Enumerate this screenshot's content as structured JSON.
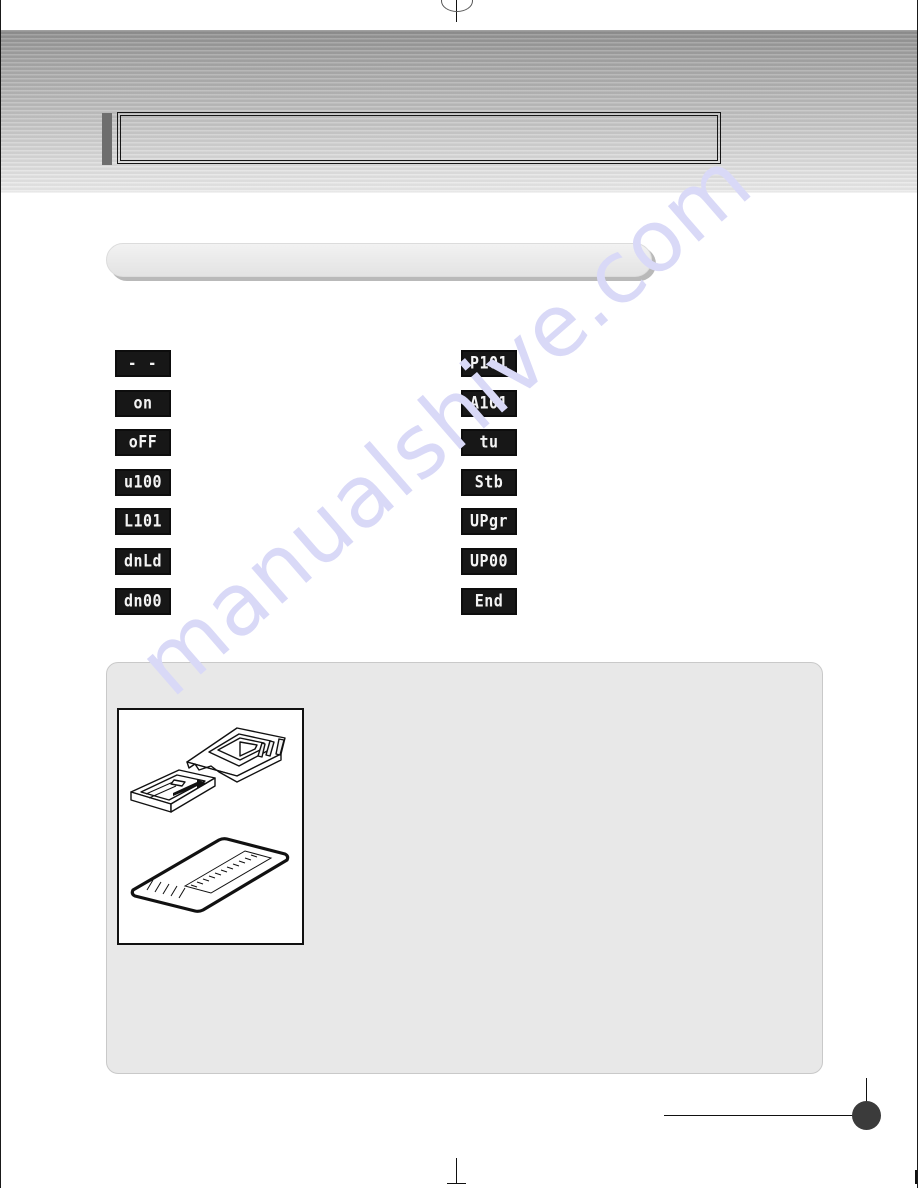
{
  "document": {
    "header_title": "",
    "section_title": "",
    "watermark": "manualshive.com"
  },
  "indicators": {
    "left_column": [
      {
        "display": "- - - -",
        "name": "lcd-dashes"
      },
      {
        "display": "on",
        "name": "lcd-on"
      },
      {
        "display": "oFF",
        "name": "lcd-off"
      },
      {
        "display": "u100",
        "name": "lcd-u100"
      },
      {
        "display": "L101",
        "name": "lcd-l101"
      },
      {
        "display": "dnLd",
        "name": "lcd-dnld"
      },
      {
        "display": "dn00",
        "name": "lcd-dn00"
      }
    ],
    "right_column": [
      {
        "display": "P101",
        "name": "lcd-p101"
      },
      {
        "display": "A101",
        "name": "lcd-a101"
      },
      {
        "display": "tu",
        "name": "lcd-tu"
      },
      {
        "display": "Stb",
        "name": "lcd-stb"
      },
      {
        "display": "UPgr",
        "name": "lcd-upgr"
      },
      {
        "display": "UP00",
        "name": "lcd-up00"
      },
      {
        "display": "End",
        "name": "lcd-end"
      }
    ]
  },
  "note_panel": {
    "body_text": "",
    "figure_caption": "",
    "figure_alt": "pcmcia-card-adapter-and-memory-card-illustration"
  },
  "footer": {
    "page_number": ""
  },
  "colors": {
    "header_gradient_top": "#8e8e8e",
    "header_gradient_bottom": "#ececec",
    "lcd_background": "#171717",
    "lcd_text": "#f4f4f4",
    "panel_background": "#e8e8e8",
    "footer_dot": "#3b3b3b",
    "watermark": "#d9d9f7"
  }
}
